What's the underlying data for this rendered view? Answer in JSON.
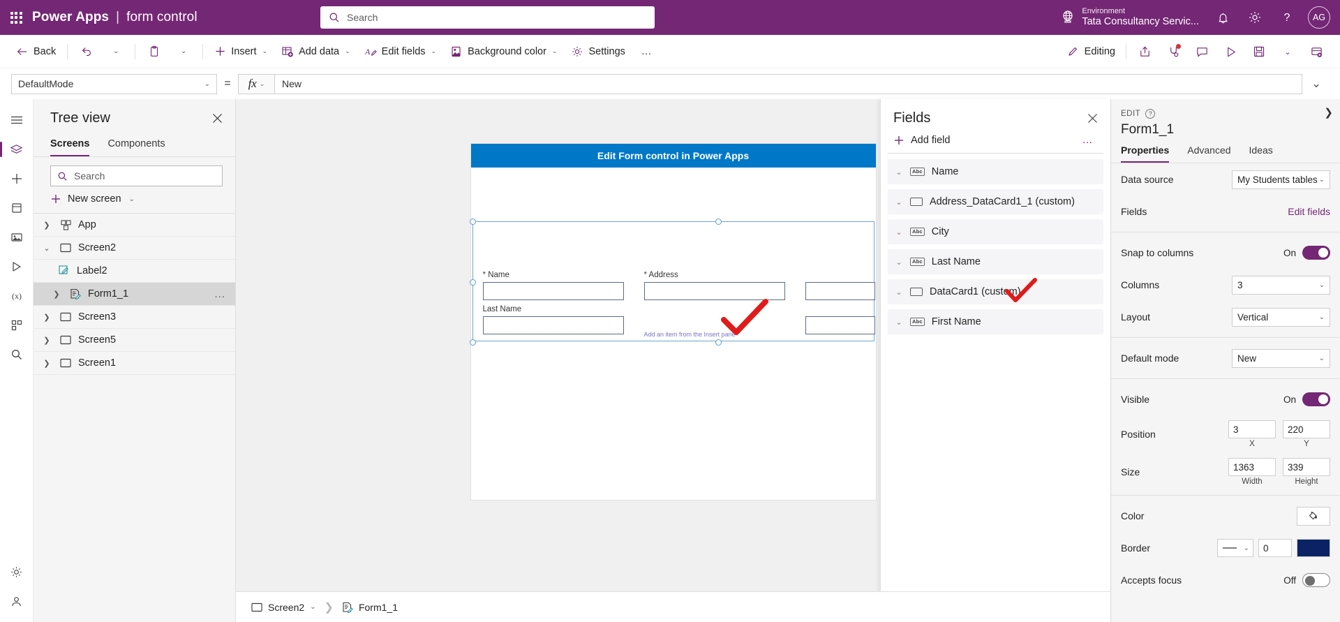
{
  "topbar": {
    "waffle": "app-launcher",
    "brand": "Power Apps",
    "separator": "|",
    "app_name": "form control",
    "search_placeholder": "Search",
    "environment_label": "Environment",
    "environment_name": "Tata Consultancy Servic...",
    "avatar_initials": "AG",
    "icons": [
      "globe-icon",
      "bell-icon",
      "gear-icon",
      "help-icon"
    ],
    "accent": "#742774"
  },
  "commandbar": {
    "back": "Back",
    "insert": "Insert",
    "add_data": "Add data",
    "edit_fields": "Edit fields",
    "background_color": "Background color",
    "settings": "Settings",
    "overflow": "…",
    "editing": "Editing",
    "right_icons": [
      "share-icon",
      "app-checker-icon",
      "comments-icon",
      "preview-icon",
      "save-icon",
      "chevron-down-icon",
      "publish-icon"
    ]
  },
  "formulabar": {
    "property": "DefaultMode",
    "equals": "=",
    "fx": "fx",
    "formula": "New"
  },
  "rail": {
    "items": [
      "hamburger-icon",
      "tree-view-icon",
      "insert-icon",
      "data-icon",
      "media-icon",
      "power-automate-icon",
      "variables-icon",
      "components-icon",
      "search-icon"
    ],
    "bottom_items": [
      "settings-icon",
      "account-icon"
    ]
  },
  "treeview": {
    "title": "Tree view",
    "close": "×",
    "tabs": [
      {
        "label": "Screens",
        "active": true
      },
      {
        "label": "Components",
        "active": false
      }
    ],
    "search_placeholder": "Search",
    "new_screen": "New screen",
    "items": [
      {
        "label": "App",
        "icon": "app-icon",
        "indent": 0,
        "expander": "collapsed",
        "selected": false
      },
      {
        "label": "Screen2",
        "icon": "screen-icon",
        "indent": 0,
        "expander": "expanded",
        "selected": false
      },
      {
        "label": "Label2",
        "icon": "label-icon",
        "indent": 1,
        "expander": "none",
        "selected": false
      },
      {
        "label": "Form1_1",
        "icon": "form-icon",
        "indent": 1,
        "expander": "collapsed",
        "selected": true,
        "more": "..."
      },
      {
        "label": "Screen3",
        "icon": "screen-icon",
        "indent": 0,
        "expander": "collapsed",
        "selected": false
      },
      {
        "label": "Screen5",
        "icon": "screen-icon",
        "indent": 0,
        "expander": "collapsed",
        "selected": false
      },
      {
        "label": "Screen1",
        "icon": "screen-icon",
        "indent": 0,
        "expander": "collapsed",
        "selected": false
      }
    ]
  },
  "canvas": {
    "app_banner_title": "Edit Form control in Power Apps",
    "form_fields": [
      {
        "label": "Name",
        "required": true
      },
      {
        "label": "Address",
        "required": true
      },
      {
        "label": "Last Name",
        "required": false
      }
    ],
    "hint_text": "Add an item from the Insert pane",
    "annotation": "red-checkmark"
  },
  "fields_panel": {
    "title": "Fields",
    "close": "×",
    "add_field": "Add field",
    "overflow": "…",
    "items": [
      {
        "label": "Name",
        "icon": "abc-icon"
      },
      {
        "label": "Address_DataCard1_1 (custom)",
        "icon": "rect-icon"
      },
      {
        "label": "City",
        "icon": "abc-icon"
      },
      {
        "label": "Last Name",
        "icon": "abc-icon"
      },
      {
        "label": "DataCard1 (custom)",
        "icon": "rect-icon"
      },
      {
        "label": "First Name",
        "icon": "abc-icon"
      }
    ]
  },
  "properties": {
    "edit_label": "EDIT",
    "control_name": "Form1_1",
    "tabs": [
      {
        "label": "Properties",
        "active": true
      },
      {
        "label": "Advanced",
        "active": false
      },
      {
        "label": "Ideas",
        "active": false
      }
    ],
    "rows": {
      "data_source_label": "Data source",
      "data_source_value": "My Students tables",
      "fields_label": "Fields",
      "fields_link": "Edit fields",
      "snap_label": "Snap to columns",
      "snap_state": "On",
      "columns_label": "Columns",
      "columns_value": "3",
      "layout_label": "Layout",
      "layout_value": "Vertical",
      "default_mode_label": "Default mode",
      "default_mode_value": "New",
      "visible_label": "Visible",
      "visible_state": "On",
      "position_label": "Position",
      "position_x": "3",
      "position_y": "220",
      "x_sub": "X",
      "y_sub": "Y",
      "size_label": "Size",
      "size_width": "1363",
      "size_height": "339",
      "width_sub": "Width",
      "height_sub": "Height",
      "color_label": "Color",
      "border_label": "Border",
      "border_width": "0",
      "border_color": "#0b2265",
      "accepts_focus_label": "Accepts focus",
      "accepts_focus_state": "Off"
    }
  },
  "footer": {
    "screen_crumb": "Screen2",
    "control_crumb": "Form1_1"
  }
}
